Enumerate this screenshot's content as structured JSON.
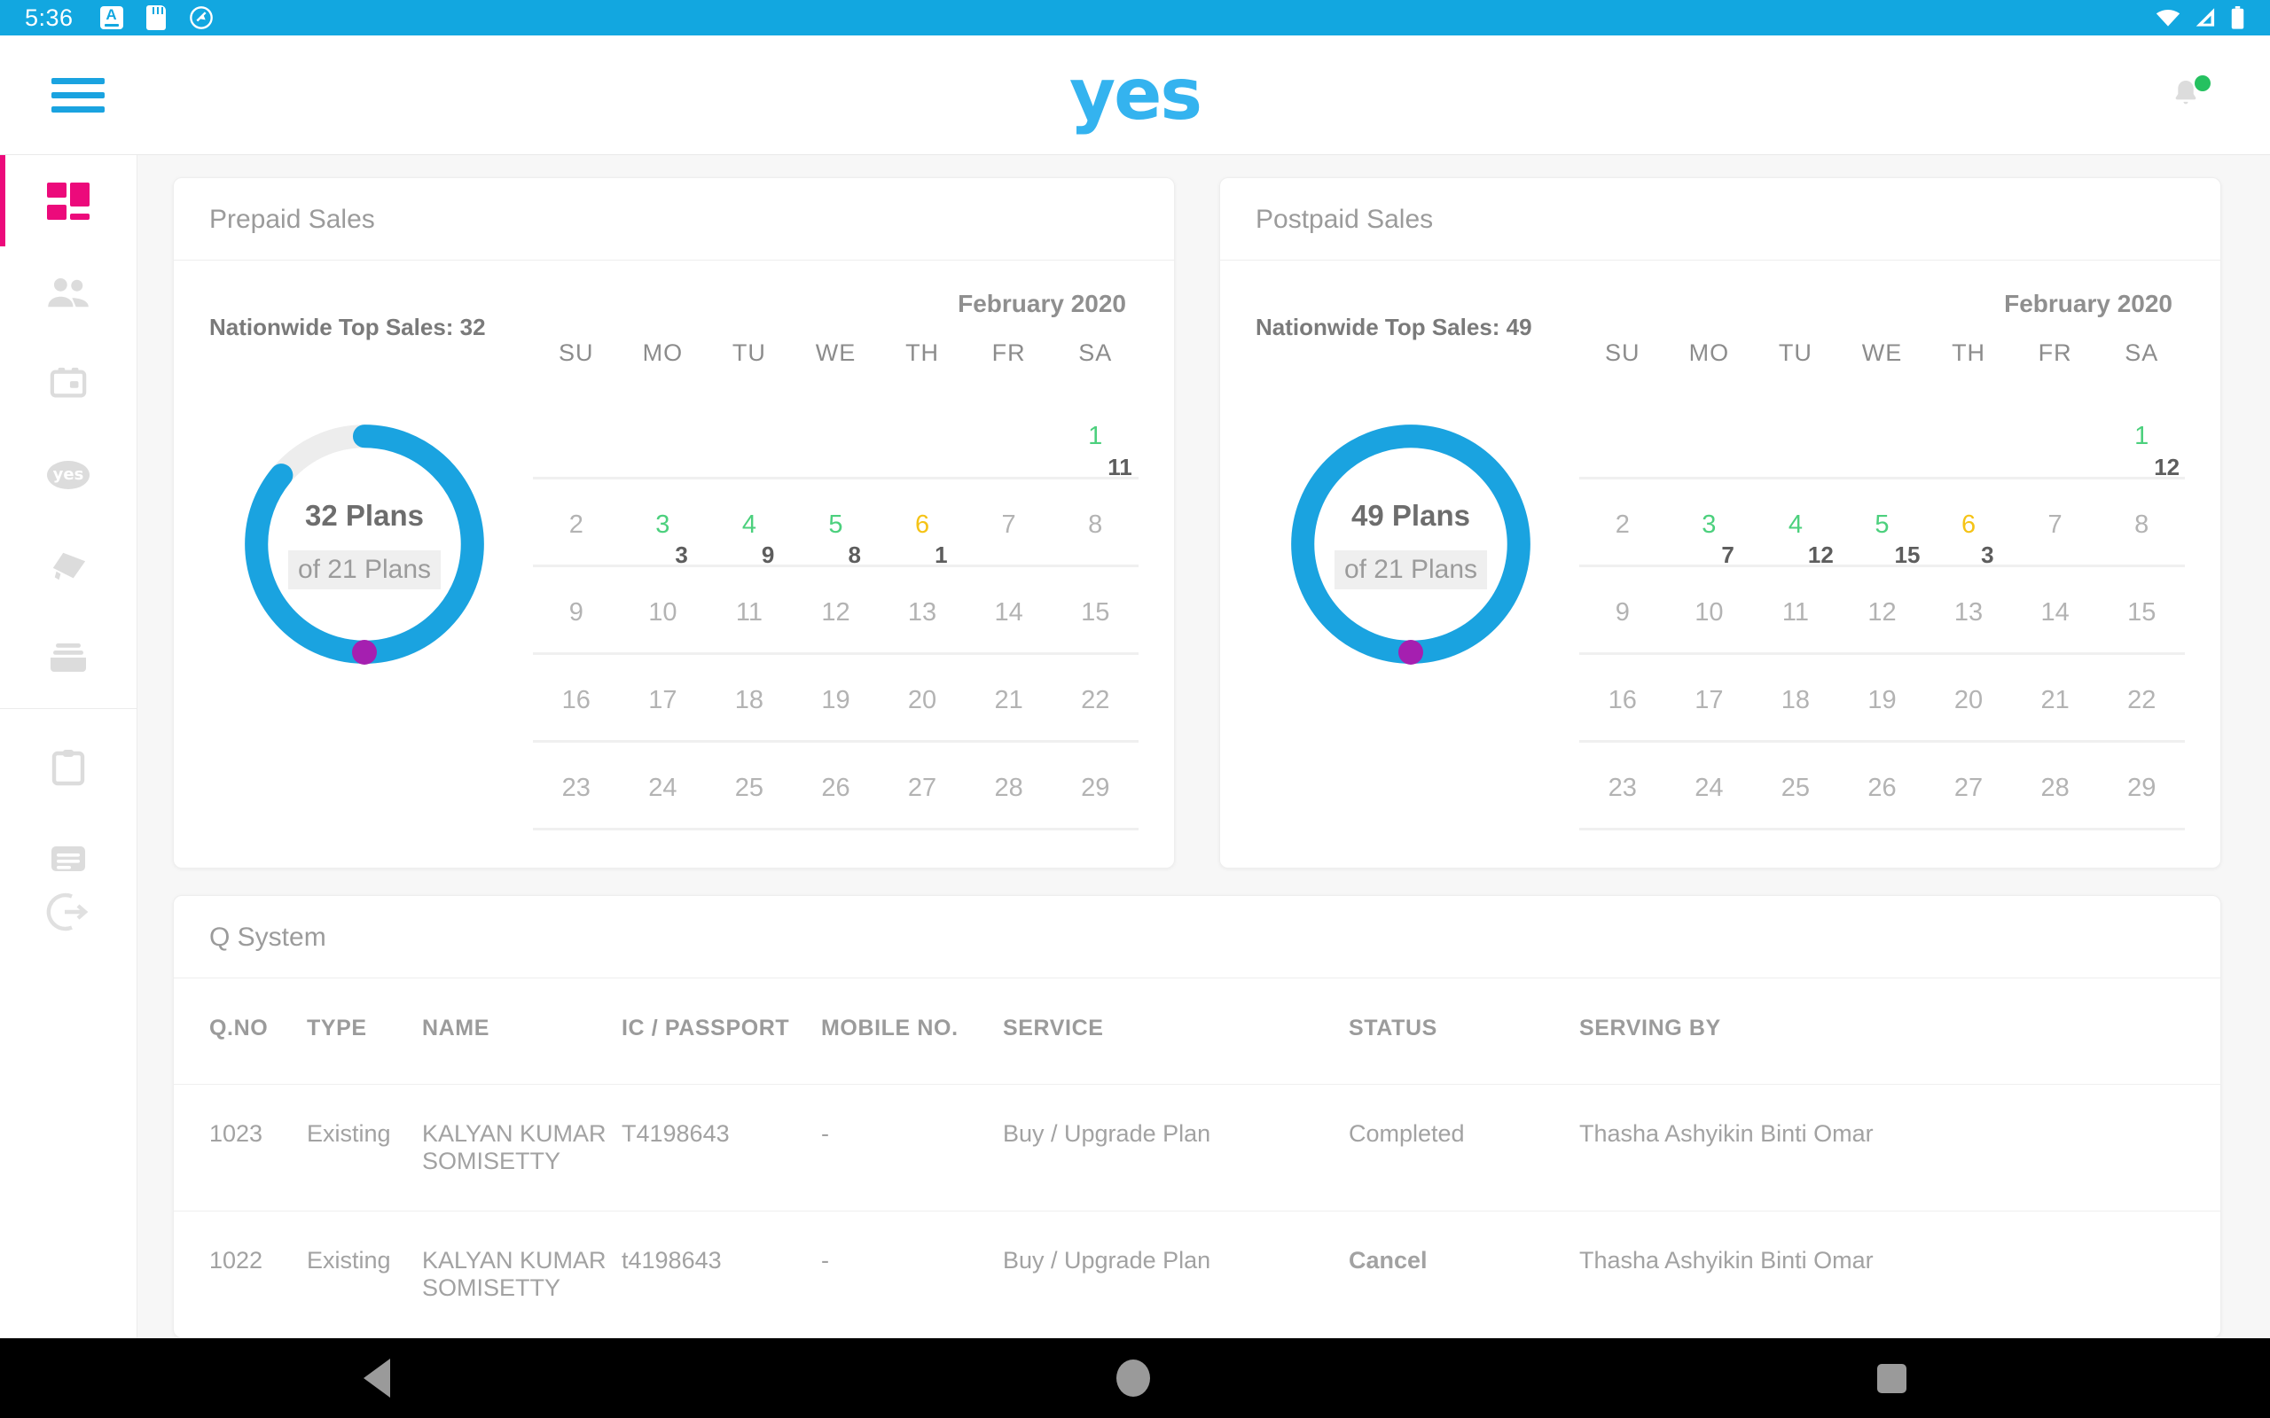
{
  "status_bar": {
    "time": "5:36",
    "left_icons": [
      "keyboard-icon",
      "sd-card-icon",
      "android-q-icon"
    ],
    "right_icons": [
      "wifi-icon",
      "cellular-signal-icon",
      "battery-icon"
    ],
    "background_color": "#12a7e0"
  },
  "app_bar": {
    "menu_icon": "hamburger-menu-icon",
    "logo_text": "yes",
    "logo_color": "#34b3ef",
    "notification_icon": "bell-icon",
    "notification_badge_color": "#25c160"
  },
  "sidebar": {
    "active_indicator_color": "#ec0a7b",
    "items": [
      {
        "name": "dashboard",
        "icon": "dashboard-grid-icon",
        "active": true
      },
      {
        "name": "customers",
        "icon": "people-icon",
        "active": false
      },
      {
        "name": "plans",
        "icon": "sim-card-icon",
        "active": false
      },
      {
        "name": "yes-services",
        "icon": "yes-oval-icon",
        "label": "yes",
        "active": false
      },
      {
        "name": "devices",
        "icon": "layers-icon",
        "active": false
      },
      {
        "name": "inbox",
        "icon": "inbox-icon",
        "active": false
      },
      {
        "name": "reports",
        "icon": "clipboard-icon",
        "active": false
      },
      {
        "name": "documents",
        "icon": "document-list-icon",
        "active": false
      }
    ],
    "logout": {
      "name": "logout",
      "icon": "logout-arrow-icon"
    }
  },
  "cards": {
    "prepaid": {
      "title": "Prepaid Sales",
      "top_sales_label": "Nationwide Top Sales: 32",
      "donut": {
        "main": "32 Plans",
        "sub": "of 21 Plans",
        "percent": 86,
        "ring_color": "#1aa3e0",
        "track_color": "#ededed",
        "marker_color": "#a51fb0"
      },
      "calendar": {
        "month": "February 2020",
        "dow": [
          "SU",
          "MO",
          "TU",
          "WE",
          "TH",
          "FR",
          "SA"
        ],
        "weeks": [
          [
            {
              "day": ""
            },
            {
              "day": ""
            },
            {
              "day": ""
            },
            {
              "day": ""
            },
            {
              "day": ""
            },
            {
              "day": ""
            },
            {
              "day": "1",
              "state": "green",
              "count": "11"
            }
          ],
          [
            {
              "day": "2"
            },
            {
              "day": "3",
              "state": "green",
              "count": "3"
            },
            {
              "day": "4",
              "state": "green",
              "count": "9"
            },
            {
              "day": "5",
              "state": "green",
              "count": "8"
            },
            {
              "day": "6",
              "state": "amber",
              "count": "1"
            },
            {
              "day": "7"
            },
            {
              "day": "8"
            }
          ],
          [
            {
              "day": "9"
            },
            {
              "day": "10"
            },
            {
              "day": "11"
            },
            {
              "day": "12"
            },
            {
              "day": "13"
            },
            {
              "day": "14"
            },
            {
              "day": "15"
            }
          ],
          [
            {
              "day": "16"
            },
            {
              "day": "17"
            },
            {
              "day": "18"
            },
            {
              "day": "19"
            },
            {
              "day": "20"
            },
            {
              "day": "21"
            },
            {
              "day": "22"
            }
          ],
          [
            {
              "day": "23"
            },
            {
              "day": "24"
            },
            {
              "day": "25"
            },
            {
              "day": "26"
            },
            {
              "day": "27"
            },
            {
              "day": "28"
            },
            {
              "day": "29"
            }
          ]
        ]
      }
    },
    "postpaid": {
      "title": "Postpaid Sales",
      "top_sales_label": "Nationwide Top Sales: 49",
      "donut": {
        "main": "49 Plans",
        "sub": "of 21 Plans",
        "percent": 100,
        "ring_color": "#1aa3e0",
        "track_color": "#ededed",
        "marker_color": "#a51fb0"
      },
      "calendar": {
        "month": "February 2020",
        "dow": [
          "SU",
          "MO",
          "TU",
          "WE",
          "TH",
          "FR",
          "SA"
        ],
        "weeks": [
          [
            {
              "day": ""
            },
            {
              "day": ""
            },
            {
              "day": ""
            },
            {
              "day": ""
            },
            {
              "day": ""
            },
            {
              "day": ""
            },
            {
              "day": "1",
              "state": "green",
              "count": "12"
            }
          ],
          [
            {
              "day": "2"
            },
            {
              "day": "3",
              "state": "green",
              "count": "7"
            },
            {
              "day": "4",
              "state": "green",
              "count": "12"
            },
            {
              "day": "5",
              "state": "green",
              "count": "15"
            },
            {
              "day": "6",
              "state": "amber",
              "count": "3"
            },
            {
              "day": "7"
            },
            {
              "day": "8"
            }
          ],
          [
            {
              "day": "9"
            },
            {
              "day": "10"
            },
            {
              "day": "11"
            },
            {
              "day": "12"
            },
            {
              "day": "13"
            },
            {
              "day": "14"
            },
            {
              "day": "15"
            }
          ],
          [
            {
              "day": "16"
            },
            {
              "day": "17"
            },
            {
              "day": "18"
            },
            {
              "day": "19"
            },
            {
              "day": "20"
            },
            {
              "day": "21"
            },
            {
              "day": "22"
            }
          ],
          [
            {
              "day": "23"
            },
            {
              "day": "24"
            },
            {
              "day": "25"
            },
            {
              "day": "26"
            },
            {
              "day": "27"
            },
            {
              "day": "28"
            },
            {
              "day": "29"
            }
          ]
        ]
      }
    },
    "q_system": {
      "title": "Q System",
      "columns": [
        "Q.NO",
        "TYPE",
        "NAME",
        "IC / PASSPORT",
        "MOBILE NO.",
        "SERVICE",
        "STATUS",
        "SERVING BY"
      ],
      "rows": [
        {
          "qno": "1023",
          "type": "Existing",
          "name": "KALYAN KUMAR SOMISETTY",
          "ic": "T4198643",
          "mobile": "-",
          "service": "Buy / Upgrade Plan",
          "status": "Completed",
          "status_style": "completed",
          "serving_by": "Thasha Ashyikin Binti Omar"
        },
        {
          "qno": "1022",
          "type": "Existing",
          "name": "KALYAN KUMAR SOMISETTY",
          "ic": "t4198643",
          "mobile": "-",
          "service": "Buy / Upgrade Plan",
          "status": "Cancel",
          "status_style": "cancel",
          "serving_by": "Thasha Ashyikin Binti Omar"
        }
      ],
      "status_colors": {
        "completed": "#3ecf6d",
        "cancel": "#111111"
      }
    }
  },
  "nav_bar": {
    "back": "back-triangle-icon",
    "home": "home-circle-icon",
    "recents": "recents-square-icon"
  }
}
